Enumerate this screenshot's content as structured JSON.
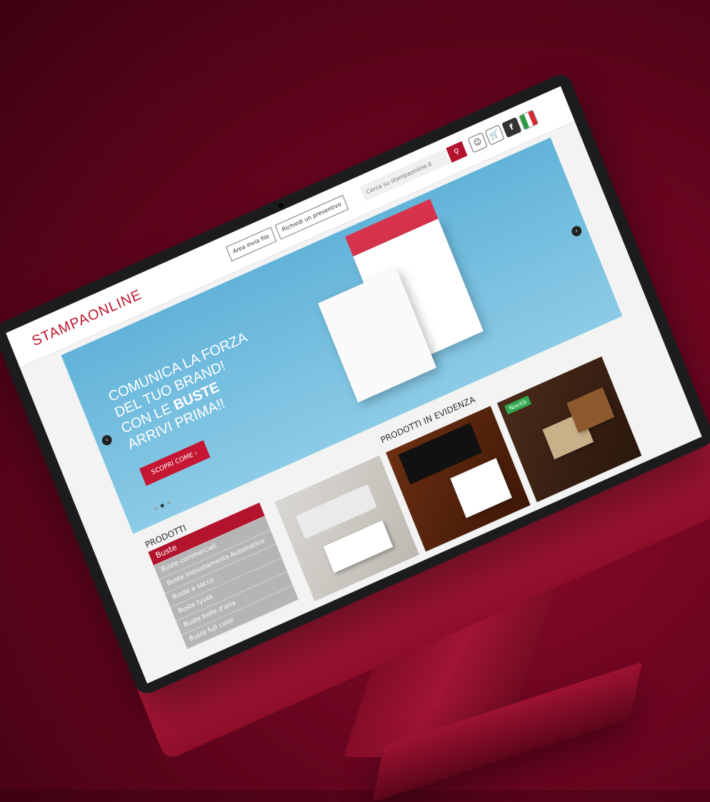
{
  "header": {
    "logo": "STAMPAONLINE",
    "upload_label": "Area invia file",
    "quote_label": "Richiedi un preventivo",
    "search_placeholder": "Cerca su stampaonline.it",
    "search_icon": "search-icon",
    "icons": [
      "user-icon",
      "cart-icon",
      "facebook-icon",
      "italy-flag-icon"
    ]
  },
  "hero": {
    "line1": "COMUNICA LA FORZA",
    "line2": "DEL TUO BRAND!",
    "line3_prefix": "CON LE ",
    "line3_bold": "BUSTE",
    "line4": "ARRIVI PRIMA!!",
    "cta_label": "SCOPRI COME ›",
    "slide_count": 3,
    "active_slide": 2
  },
  "products": {
    "title": "PRODOTTI",
    "items": [
      {
        "label": "Buste"
      },
      {
        "label": "Buste commerciali"
      },
      {
        "label": "Buste Imbustamento Automatico"
      },
      {
        "label": "Buste a sacco"
      },
      {
        "label": "Buste tyvek"
      },
      {
        "label": "Buste bolle d'aria"
      },
      {
        "label": "Buste full color"
      }
    ],
    "active_item": "Buste"
  },
  "featured": {
    "title": "PRODOTTI IN EVIDENZA",
    "badge": "Novità"
  },
  "colors": {
    "accent": "#b3142d",
    "hero_bg": "#62b3d9",
    "device": "#c01b3d"
  }
}
